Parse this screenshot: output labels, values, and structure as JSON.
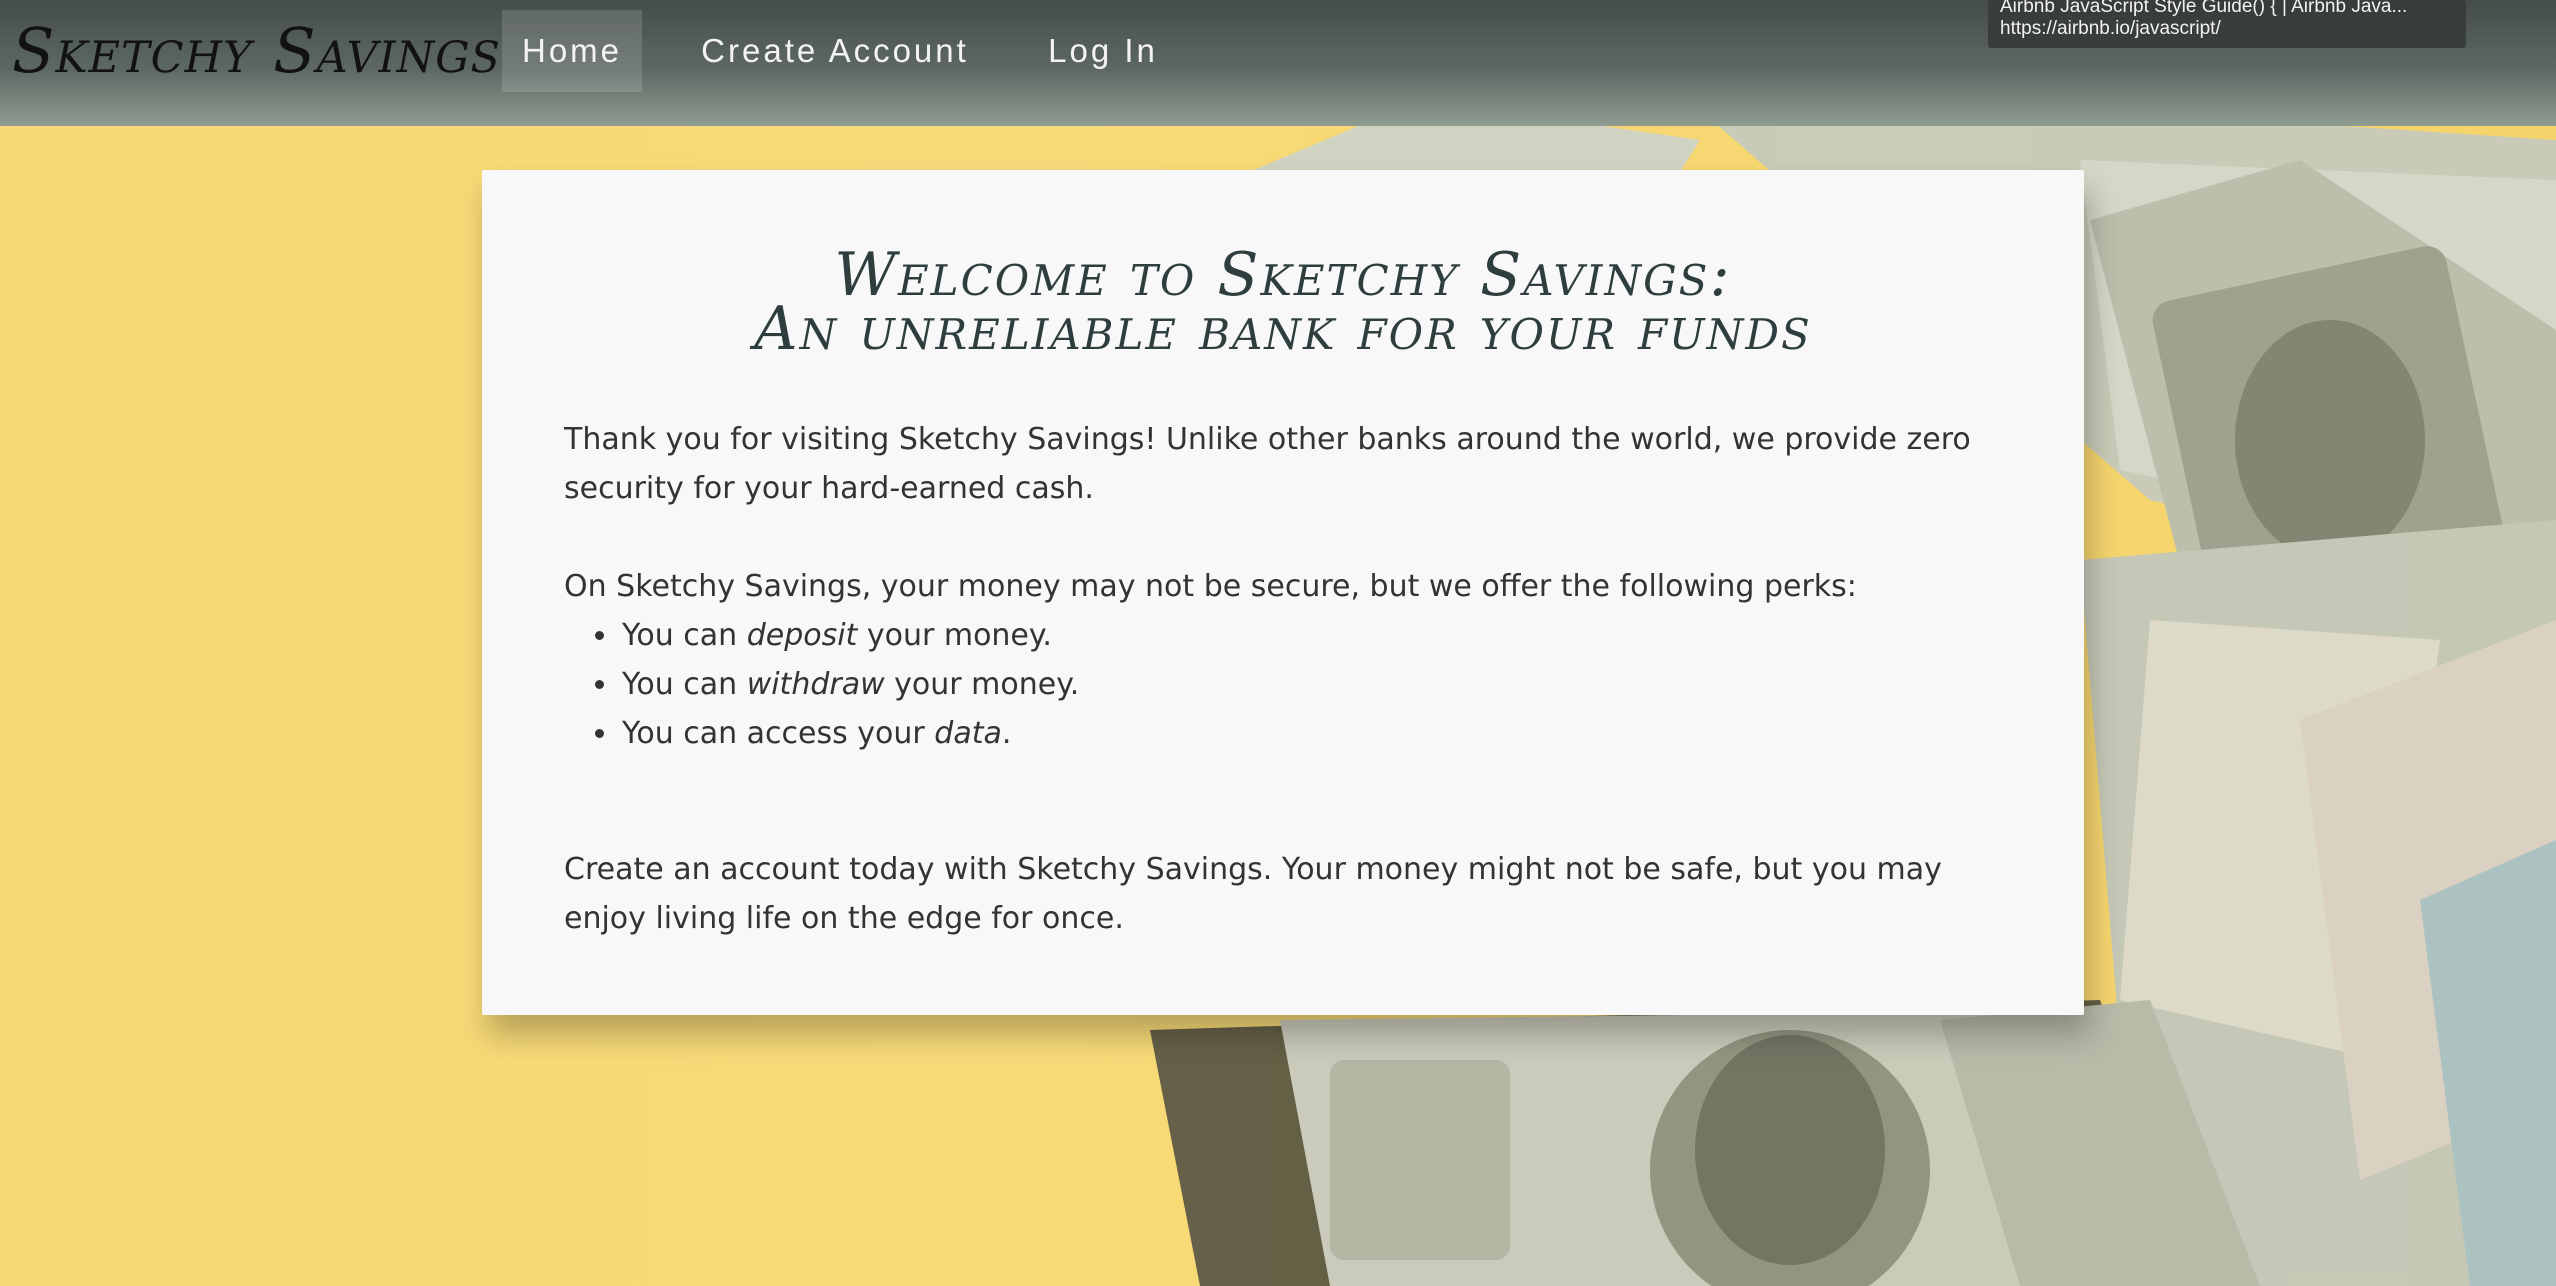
{
  "navbar": {
    "brand": "Sketchy Savings",
    "items": [
      {
        "label": "Home",
        "active": true
      },
      {
        "label": "Create Account",
        "active": false
      },
      {
        "label": "Log In",
        "active": false
      }
    ]
  },
  "tooltip": {
    "title": "Airbnb JavaScript Style Guide() { | Airbnb Java...",
    "url": "https://airbnb.io/javascript/"
  },
  "card": {
    "title_line1": "Welcome to Sketchy Savings:",
    "title_line2": "An unreliable bank for your funds",
    "intro": "Thank you for visiting Sketchy Savings! Unlike other banks around the world, we provide zero security for your hard-earned cash.",
    "perks_intro": "On Sketchy Savings, your money may not be secure, but we offer the following perks:",
    "perks": [
      {
        "pre": "You can ",
        "em": "deposit",
        "post": " your money."
      },
      {
        "pre": "You can ",
        "em": "withdraw",
        "post": " your money."
      },
      {
        "pre": "You can access your ",
        "em": "data",
        "post": "."
      }
    ],
    "cta": "Create an account today with Sketchy Savings. Your money might not be safe, but you may enjoy living life on the edge for once."
  },
  "colors": {
    "background_yellow": "#f7d774",
    "navbar_top": "#444c4c",
    "navbar_bottom": "#8e9c91",
    "card_bg": "#f8f8f8",
    "title_color": "#2e3e3e"
  }
}
